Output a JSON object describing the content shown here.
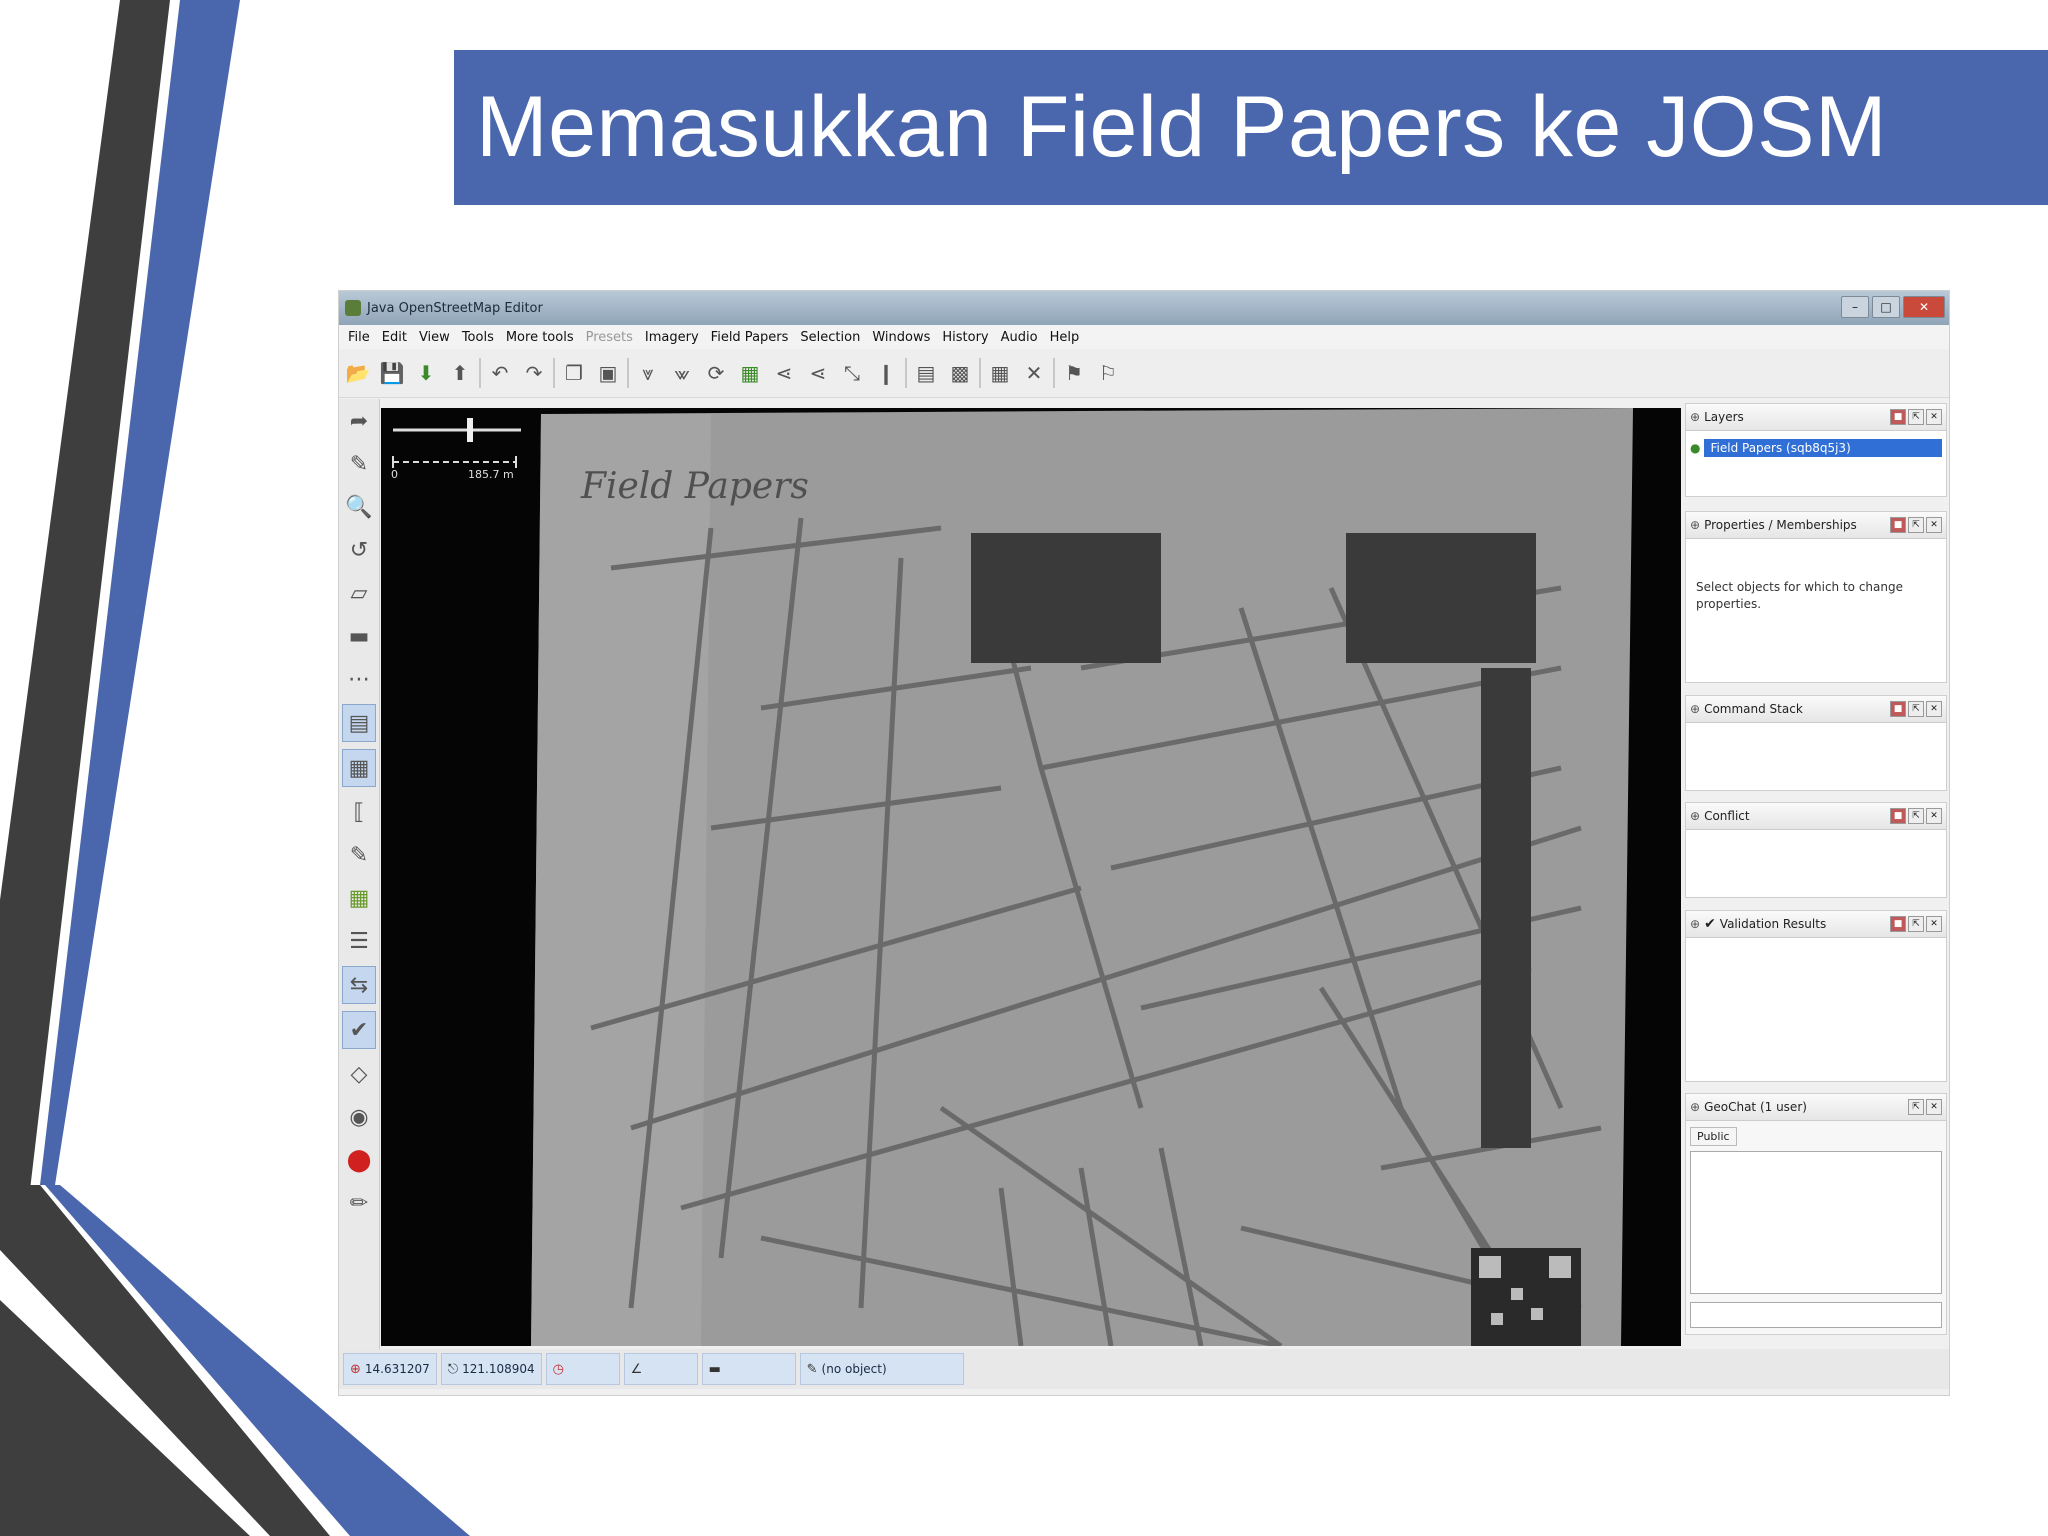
{
  "slide": {
    "title": "Memasukkan Field Papers ke JOSM"
  },
  "colors": {
    "accent_blue": "#4a67ad",
    "dark_stripe": "#3a3a3a"
  },
  "josm": {
    "window_title": "Java OpenStreetMap Editor",
    "window_controls": [
      "–",
      "□",
      "✕"
    ],
    "menu": [
      "File",
      "Edit",
      "View",
      "Tools",
      "More tools",
      "Presets",
      "Imagery",
      "Field Papers",
      "Selection",
      "Windows",
      "History",
      "Audio",
      "Help"
    ],
    "toolbar_icons": [
      "open-icon",
      "save-icon",
      "download-icon",
      "upload-icon",
      "undo-icon",
      "redo-icon",
      "copy-icon",
      "paste-icon",
      "split-icon",
      "combine-icon",
      "refresh-icon",
      "select-icon",
      "align-icon",
      "distribute-icon",
      "mirror-icon",
      "pin-icon",
      "print-icon",
      "delete-icon",
      "close-icon",
      "map-icon",
      "flag-icon"
    ],
    "left_tools": [
      "select-tool-icon",
      "draw-tool-icon",
      "zoom-tool-icon",
      "delete-tool-icon",
      "improve-way-icon",
      "parallel-icon",
      "imagery-icon",
      "layers-toggle-icon",
      "properties-toggle-icon",
      "command-stack-icon",
      "conflict-icon",
      "validation-icon",
      "filter-icon",
      "notes-icon",
      "stop-icon",
      "measure-icon",
      "geochat-icon"
    ],
    "scale": {
      "left_label": "0",
      "right_label": "185.7 m"
    },
    "panels": {
      "layers": {
        "title": "Layers",
        "item": "Field Papers (sqb8q5j3)"
      },
      "properties": {
        "title": "Properties / Memberships",
        "hint": "Select objects for which to change properties."
      },
      "command_stack": {
        "title": "Command Stack"
      },
      "conflict": {
        "title": "Conflict"
      },
      "validation": {
        "title": "Validation Results"
      },
      "geochat": {
        "title": "GeoChat (1 user)",
        "tab": "Public"
      }
    },
    "status": {
      "lat": "14.631207",
      "lon": "121.108904",
      "heading": "",
      "length": "",
      "zoom": "(no object)"
    }
  }
}
